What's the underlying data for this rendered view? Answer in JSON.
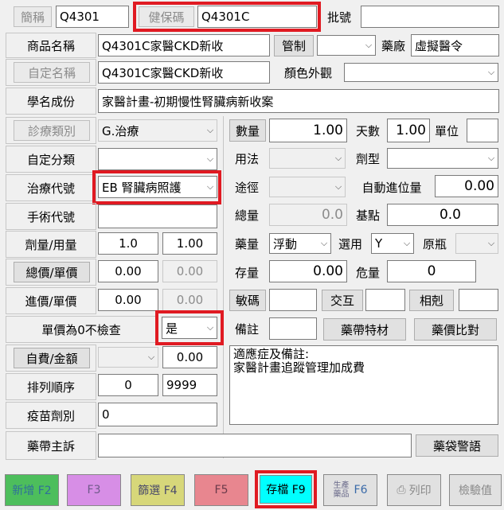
{
  "row1": {
    "short_name_btn": "簡稱",
    "short_name_value": "Q4301",
    "ins_code_btn": "健保碼",
    "ins_code_value": "Q4301C",
    "approval_label": "批號",
    "approval_value": ""
  },
  "row2": {
    "product_name_label": "商品名稱",
    "product_name_value": "Q4301C家醫CKD新收",
    "control_btn": "管制",
    "control_value": "",
    "manufacturer_label": "藥廠",
    "manufacturer_value": "虛擬醫令"
  },
  "row3": {
    "custom_name_btn": "自定名稱",
    "custom_name_value": "Q4301C家醫CKD新收",
    "appearance_label": "顏色外觀",
    "appearance_value": ""
  },
  "row4": {
    "generic_label": "學名成份",
    "generic_value": "家醫計畫-初期慢性腎臟病新收案"
  },
  "row5": {
    "category_btn": "診療類別",
    "category_value": "G.治療",
    "qty_btn": "數量",
    "qty_value": "1.00",
    "days_label": "天數",
    "days_value": "1.00",
    "unit_label": "單位",
    "unit_value": ""
  },
  "row6": {
    "custom_class_label": "自定分類",
    "custom_class_value": "",
    "usage_label": "用法",
    "usage_value": "",
    "dosage_form_label": "劑型",
    "dosage_form_value": ""
  },
  "row7": {
    "treat_code_label": "治療代號",
    "treat_code_value": "EB 腎臟病照護",
    "route_label": "途徑",
    "route_value": "",
    "auto_carry_label": "自動進位量",
    "auto_carry_value": "0.00"
  },
  "row8": {
    "surgery_code_label": "手術代號",
    "surgery_code_value": "",
    "total_label": "總量",
    "total_value": "0.0",
    "base_point_label": "基點",
    "base_point_value": "0.0"
  },
  "row9": {
    "dose_label": "劑量/用量",
    "dose_value": "1.0",
    "usage_qty_value": "1.00",
    "drug_qty_label": "藥量",
    "drug_qty_value": "浮動",
    "select_label": "選用",
    "select_value": "Y",
    "original_label": "原瓶",
    "original_value": ""
  },
  "row10": {
    "total_price_btn": "總價/單價",
    "total_price_value": "0.00",
    "unit_price_value": "0.00",
    "stock_label": "存量",
    "stock_value": "0.00",
    "danger_label": "危量",
    "danger_value": "0"
  },
  "row11": {
    "purchase_label": "進價/單價",
    "purchase_value": "0.00",
    "purchase_unit_value": "0.00",
    "allergy_btn": "敏碼",
    "allergy_value": "",
    "interaction_btn": "交互",
    "interaction_value": "",
    "antagonist_btn": "相剋",
    "antagonist_value": ""
  },
  "row12": {
    "zero_check_label": "單價為0不檢查",
    "zero_check_value": "是",
    "remark_label": "備註",
    "remark_value": "",
    "special_material_btn": "藥帶特材",
    "price_compare_btn": "藥價比對"
  },
  "row13": {
    "self_pay_btn": "自費/金額",
    "self_pay_value": "",
    "amount_value": "0.00",
    "indication_text": "適應症及備註:\n家醫計畫追蹤管理加成費"
  },
  "row14": {
    "sort_label": "排列順序",
    "sort_value": "0",
    "sort_value2": "9999"
  },
  "row15": {
    "vaccine_label": "疫苗劑別",
    "vaccine_value": "0"
  },
  "row16": {
    "complaint_label": "藥帶主訴",
    "complaint_value": "",
    "warning_btn": "藥袋警語"
  },
  "fkeys": {
    "add": "新增 F2",
    "f3": "F3",
    "f4": "篩選 F4",
    "f5": "F5",
    "save": "存檔 F9",
    "f6_line1": "生產",
    "f6_line2": "藥品",
    "f6": "F6",
    "print": "列印",
    "check": "檢驗值"
  },
  "colors": {
    "highlight": "#e01a22",
    "save_bg": "#00ffff",
    "add_bg": "#4dbe5c",
    "f3_bg": "#d78ee6",
    "f4_bg": "#d7d77a",
    "f5_bg": "#e8868f"
  }
}
